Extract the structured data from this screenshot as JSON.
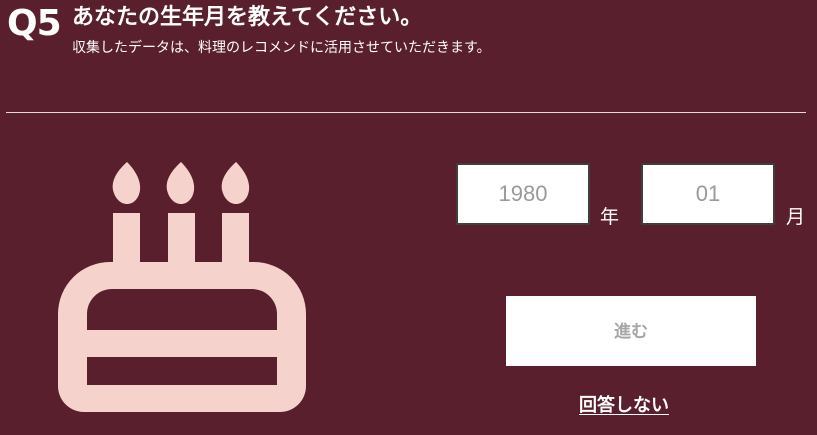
{
  "question": {
    "number": "Q5",
    "title": "あなたの生年月を教えてください。",
    "subtitle": "収集したデータは、料理のレコメンドに活用させていただきます。"
  },
  "icon": {
    "name": "birthday-cake-icon",
    "color": "#f5d3cc"
  },
  "form": {
    "year": {
      "value": "",
      "placeholder": "1980",
      "unit": "年"
    },
    "month": {
      "value": "",
      "placeholder": "01",
      "unit": "月"
    },
    "next_label": "進む",
    "skip_label": "回答しない"
  },
  "colors": {
    "background": "#5a1f2d",
    "text": "#ffffff",
    "icon": "#f5d3cc",
    "button_text": "#a6a6a6"
  }
}
